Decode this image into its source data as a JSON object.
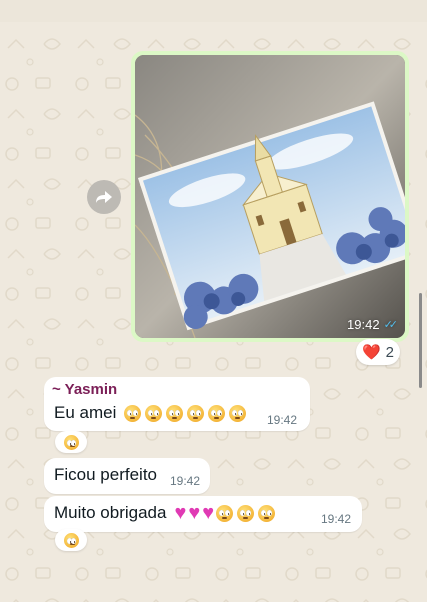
{
  "outgoing_image": {
    "time": "19:42",
    "status_icon": "double-check-read-icon"
  },
  "reaction_main": {
    "emoji": "❤️",
    "count": "2"
  },
  "messages": [
    {
      "sender": "~ Yasmin",
      "text": "Eu amei",
      "time": "19:42",
      "reaction": "🥺"
    },
    {
      "text": "Ficou perfeito",
      "time": "19:42"
    },
    {
      "text": "Muito obrigada",
      "time": "19:42",
      "reaction": "🥺"
    }
  ],
  "colors": {
    "outgoing_bubble": "#dcf8c6",
    "wallpaper": "#efe9de",
    "sender": "#7b1f57",
    "read_ticks": "#53bdeb",
    "heart": "#e03ab4"
  }
}
